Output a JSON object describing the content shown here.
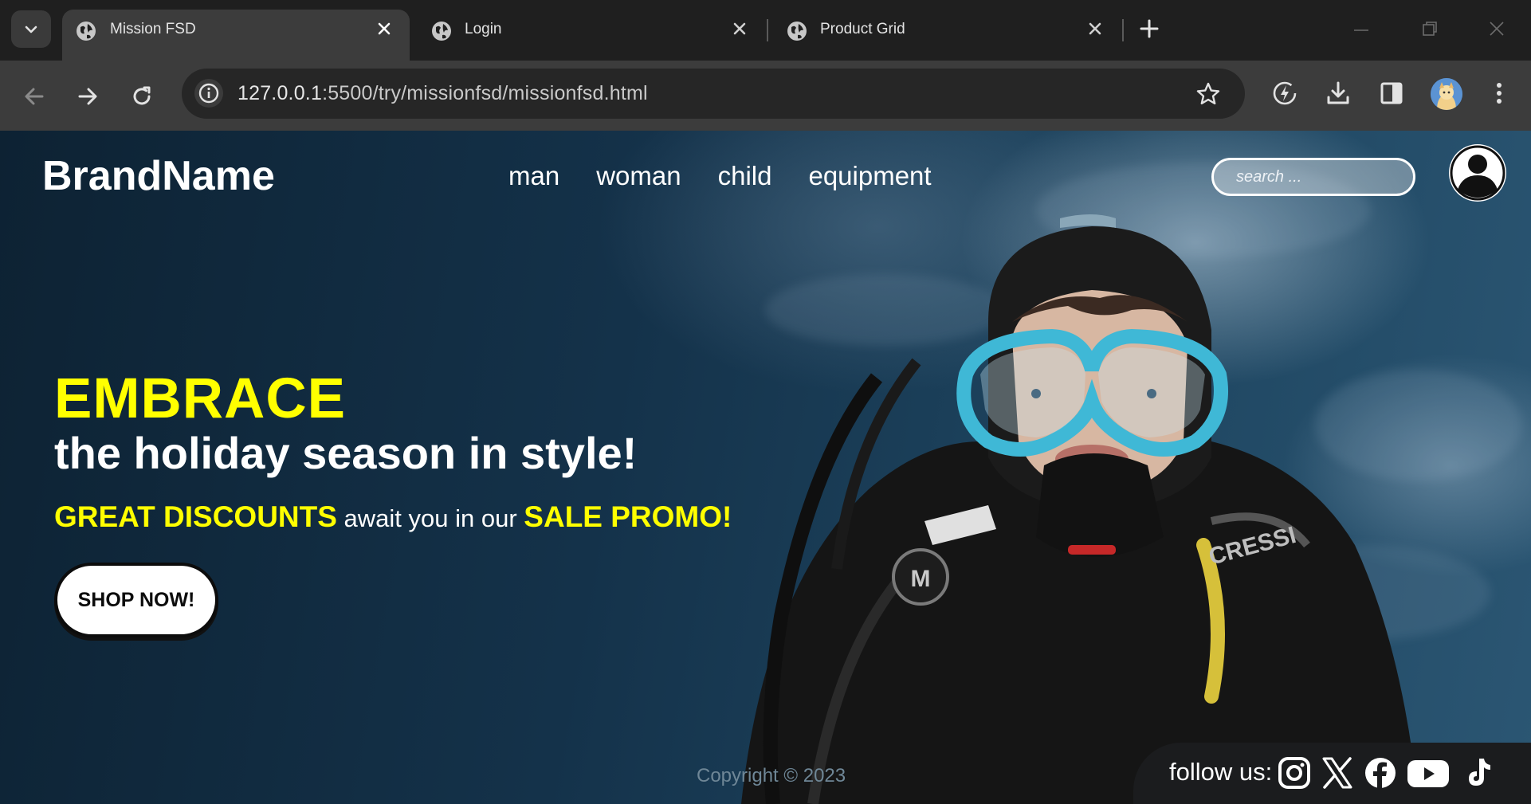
{
  "browser": {
    "tabs": [
      {
        "title": "Mission FSD",
        "active": true
      },
      {
        "title": "Login",
        "active": false
      },
      {
        "title": "Product Grid",
        "active": false
      }
    ],
    "url_host": "127.0.0.1",
    "url_rest": ":5500/try/missionfsd/missionfsd.html"
  },
  "header": {
    "brand": "BrandName",
    "nav": [
      "man",
      "woman",
      "child",
      "equipment"
    ],
    "search_placeholder": "search ..."
  },
  "hero": {
    "headline": "EMBRACE",
    "subheadline": "the holiday season in style!",
    "promo_part1": "GREAT DISCOUNTS",
    "promo_part2": " await you in our ",
    "promo_part3": "SALE PROMO!",
    "cta": "SHOP NOW!"
  },
  "footer": {
    "copyright": "Copyright © 2023",
    "follow_label": "follow us:",
    "socials": [
      "instagram-icon",
      "x-icon",
      "facebook-icon",
      "youtube-icon",
      "tiktok-icon"
    ]
  },
  "colors": {
    "accent": "#ffff00",
    "text": "#ffffff",
    "chrome_bg": "#1f1f1f",
    "toolbar_bg": "#3c3c3c"
  }
}
